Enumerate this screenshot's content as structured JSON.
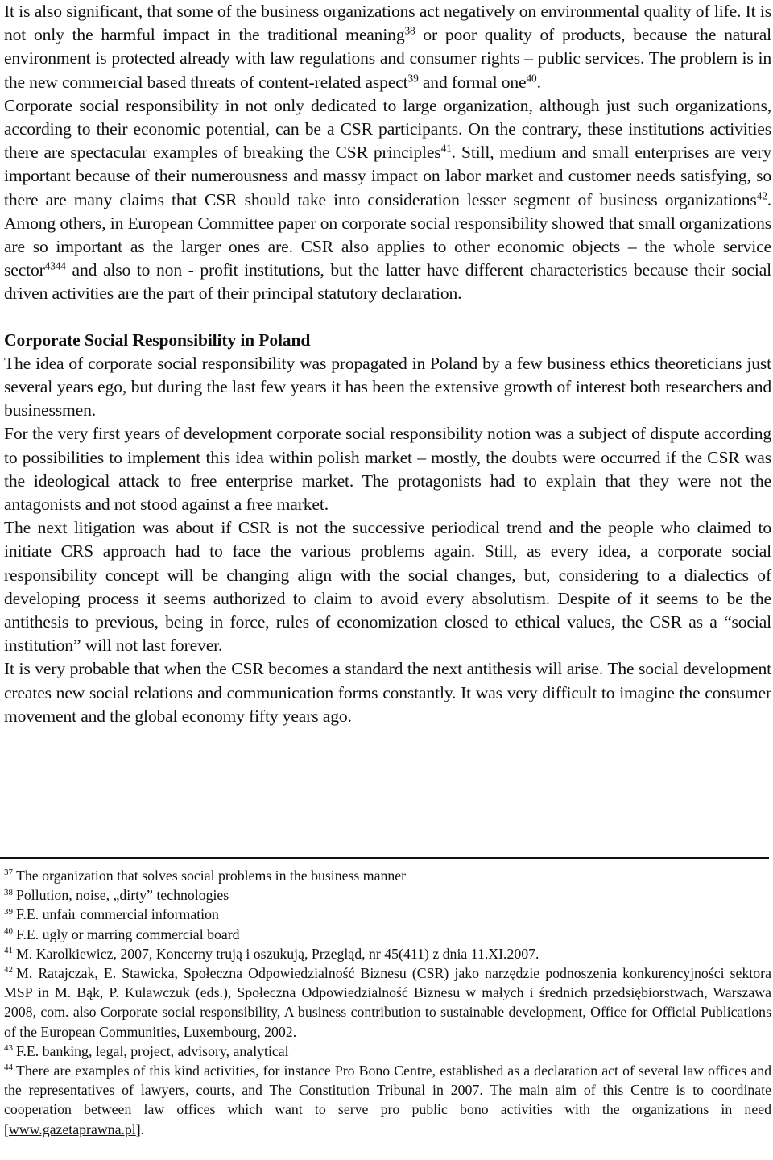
{
  "body": {
    "paragraphs": [
      {
        "segments": [
          "It is also significant, that some of the business organizations act negatively on environmental quality of life. It is not only the harmful impact in the traditional meaning",
          "38",
          " or poor quality of products, because the natural environment is protected already with law regulations and consumer rights – public services. The problem is in the new commercial based threats of content-related aspect",
          "39",
          " and formal one",
          "40",
          "."
        ]
      },
      {
        "segments": [
          "Corporate social responsibility in not only dedicated to large organization, although just such organizations, according to their economic potential, can be a CSR participants. On the contrary, these institutions activities there are spectacular examples of breaking the CSR principles",
          "41",
          ". Still, medium and small enterprises are very important because of their numerousness and massy impact on labor market and customer needs satisfying, so there are many claims that CSR should take into consideration lesser segment of business organizations",
          "42",
          ". Among others, in European Committee paper on corporate social responsibility showed that small organizations are so important as the larger ones are. CSR also applies to other economic objects – the whole service sector",
          "4344",
          " and also to non - profit institutions, but the latter have different characteristics because their social driven activities are the part of their principal statutory declaration."
        ]
      }
    ],
    "section_heading": "Corporate Social Responsibility in Poland",
    "section_paragraphs": [
      "The idea of corporate social responsibility was propagated in Poland by a few business ethics theoreticians just several years ego, but during the last few years it has been the extensive growth of interest both researchers and businessmen.",
      "For the very first years of development corporate social responsibility notion was a subject of dispute according to possibilities to implement this idea within polish market – mostly, the doubts were occurred if the CSR was the ideological attack to free enterprise market. The protagonists had to explain that they were not the antagonists and not stood against a free market.",
      "The next litigation was about if CSR is not the successive periodical trend and the people who claimed to initiate CRS approach had to face the various problems again. Still, as every idea, a corporate social responsibility concept will be changing align with the social changes, but, considering to a dialectics of developing process it seems authorized to claim to avoid every absolutism. Despite of it seems to be the antithesis to previous, being in force, rules of economization closed to ethical values, the CSR as a “social institution” will not last forever.",
      "It is very probable that when the CSR becomes a standard the next antithesis will arise. The social development creates new social relations and communication forms constantly. It was very difficult to imagine the consumer movement and the global economy fifty years ago."
    ]
  },
  "footnotes": [
    {
      "num": "37",
      "text": "The organization that solves social problems in the business manner"
    },
    {
      "num": "38",
      "text": "Pollution, noise, „dirty” technologies"
    },
    {
      "num": "39",
      "text": "F.E. unfair commercial information"
    },
    {
      "num": "40",
      "text": "F.E. ugly or marring commercial board"
    },
    {
      "num": "41",
      "text": "M. Karolkiewicz, 2007, Koncerny trują i oszukują, Przegląd, nr 45(411) z dnia 11.XI.2007."
    },
    {
      "num": "42",
      "text": "M. Ratajczak, E. Stawicka, Społeczna Odpowiedzialność Biznesu (CSR) jako narzędzie podnoszenia konkurencyjności sektora MSP in M. Bąk, P. Kulawczuk (eds.), Społeczna Odpowiedzialność Biznesu w małych i średnich przedsiębiorstwach, Warszawa 2008, com. also Corporate social responsibility, A business contribution to sustainable development, Office for Official Publications of the European Communities, Luxembourg, 2002."
    },
    {
      "num": "43",
      "text": "F.E. banking, legal, project, advisory, analytical"
    },
    {
      "num": "44",
      "text": "There are examples of this kind activities, for instance Pro Bono Centre, established as a declaration act of several law offices and the representatives of lawyers, courts, and The Constitution Tribunal in 2007. The main aim of this Centre is to coordinate cooperation between law offices which want to serve pro public bono activities with the organizations in need [",
      "link": "www.gazetaprawna.pl",
      "after": "]."
    }
  ]
}
